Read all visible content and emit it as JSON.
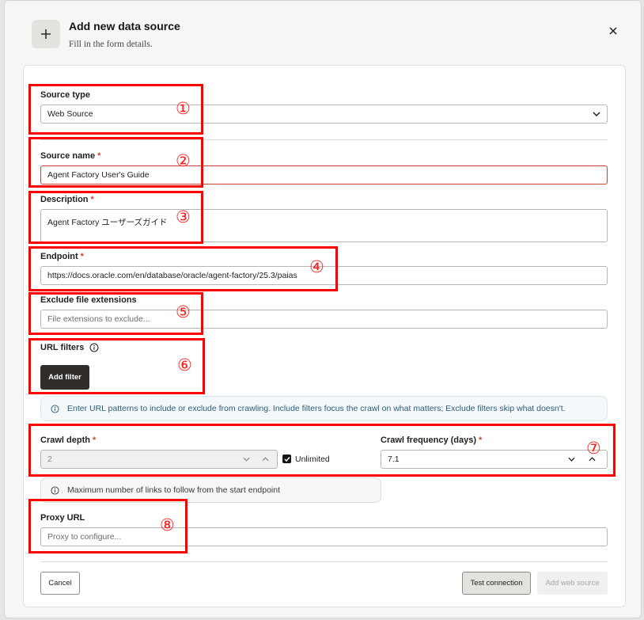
{
  "dialog": {
    "title": "Add new data source",
    "subtitle": "Fill in the form details.",
    "close_icon": "close-icon",
    "header_icon": "plus-icon"
  },
  "form": {
    "source_type": {
      "label": "Source type",
      "value": "Web Source"
    },
    "source_name": {
      "label": "Source name",
      "required": "*",
      "value": "Agent Factory User's Guide"
    },
    "description": {
      "label": "Description",
      "required": "*",
      "value": "Agent Factory ユーザーズガイド"
    },
    "endpoint": {
      "label": "Endpoint",
      "required": "*",
      "value": "https://docs.oracle.com/en/database/oracle/agent-factory/25.3/paias"
    },
    "exclude_extensions": {
      "label": "Exclude file extensions",
      "placeholder": "File extensions to exclude..."
    },
    "url_filters": {
      "label": "URL filters",
      "add_filter_label": "Add filter"
    },
    "url_info": "Enter URL patterns to include or exclude from crawling. Include filters focus the crawl on what matters; Exclude filters skip what doesn't.",
    "crawl_depth": {
      "label": "Crawl depth",
      "required": "*",
      "value": "2",
      "unlimited_label": "Unlimited"
    },
    "crawl_frequency": {
      "label": "Crawl frequency (days)",
      "required": "*",
      "value": "7.1"
    },
    "depth_info": "Maximum number of links to follow from the start endpoint",
    "proxy_url": {
      "label": "Proxy URL",
      "placeholder": "Proxy to configure..."
    }
  },
  "footer": {
    "cancel_label": "Cancel",
    "test_label": "Test connection",
    "add_label": "Add web source"
  },
  "annotations": [
    "①",
    "②",
    "③",
    "④",
    "⑤",
    "⑥",
    "⑦",
    "⑧"
  ],
  "colors": {
    "annotation": "#ff0000",
    "required": "#c74634",
    "info_text": "#2c5d7c",
    "dark_button": "#312d2a"
  }
}
